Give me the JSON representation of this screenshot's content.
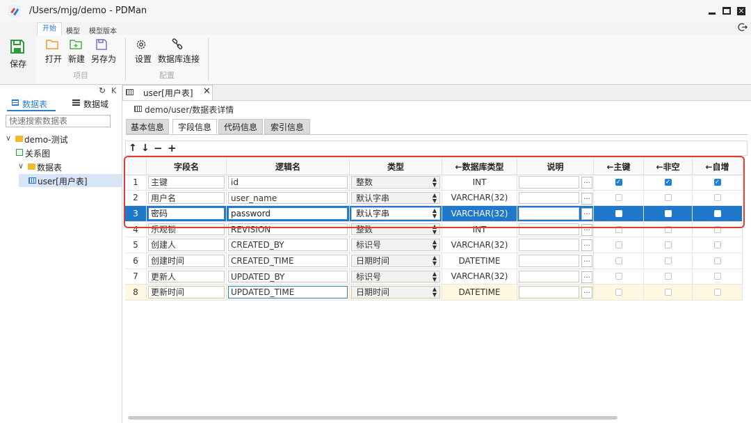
{
  "window": {
    "title": "/Users/mjg/demo - PDMan"
  },
  "ribbon": {
    "tabs": [
      "开始",
      "模型",
      "模型版本"
    ],
    "save_label": "保存",
    "group_project": {
      "label": "项目",
      "buttons": [
        "打开",
        "新建",
        "另存为"
      ]
    },
    "group_config": {
      "label": "配置",
      "buttons": [
        "设置",
        "数据库连接"
      ]
    }
  },
  "sidebar": {
    "tabs": [
      "数据表",
      "数据域"
    ],
    "refresh_label": "K",
    "search_placeholder": "快速搜索数据表",
    "tree": {
      "root": "demo-测试",
      "diagram": "关系图",
      "tables_folder": "数据表",
      "table": "user[用户表]"
    }
  },
  "editor": {
    "tab_title": "user[用户表]",
    "breadcrumb": "demo/user/数据表详情",
    "subtabs": [
      "基本信息",
      "字段信息",
      "代码信息",
      "索引信息"
    ],
    "toolbar": [
      "↑",
      "↓",
      "−",
      "+"
    ],
    "columns": [
      "字段名",
      "逻辑名",
      "类型",
      "←数据库类型",
      "说明",
      "←主键",
      "←非空",
      "←自增"
    ],
    "rows": [
      {
        "no": "1",
        "name": "主键",
        "logic": "id",
        "type": "整数",
        "db": "INT",
        "pk": true,
        "nn": true,
        "ai": true
      },
      {
        "no": "2",
        "name": "用户名",
        "logic": "user_name",
        "type": "默认字串",
        "db": "VARCHAR(32)",
        "pk": false,
        "nn": false,
        "ai": false
      },
      {
        "no": "3",
        "name": "密码",
        "logic": "password",
        "type": "默认字串",
        "db": "VARCHAR(32)",
        "pk": false,
        "nn": false,
        "ai": false
      },
      {
        "no": "4",
        "name": "乐观锁",
        "logic": "REVISION",
        "type": "整数",
        "db": "INT",
        "pk": false,
        "nn": false,
        "ai": false
      },
      {
        "no": "5",
        "name": "创建人",
        "logic": "CREATED_BY",
        "type": "标识号",
        "db": "VARCHAR(32)",
        "pk": false,
        "nn": false,
        "ai": false
      },
      {
        "no": "6",
        "name": "创建时间",
        "logic": "CREATED_TIME",
        "type": "日期时间",
        "db": "DATETIME",
        "pk": false,
        "nn": false,
        "ai": false
      },
      {
        "no": "7",
        "name": "更新人",
        "logic": "UPDATED_BY",
        "type": "标识号",
        "db": "VARCHAR(32)",
        "pk": false,
        "nn": false,
        "ai": false
      },
      {
        "no": "8",
        "name": "更新时间",
        "logic": "UPDATED_TIME",
        "type": "日期时间",
        "db": "DATETIME",
        "pk": false,
        "nn": false,
        "ai": false
      }
    ],
    "selected_row": "3",
    "highlight_row": "8"
  },
  "colors": {
    "accent": "#1f78c9",
    "highlight_border": "#e23c2c",
    "save_icon": "#2e9a3c"
  }
}
